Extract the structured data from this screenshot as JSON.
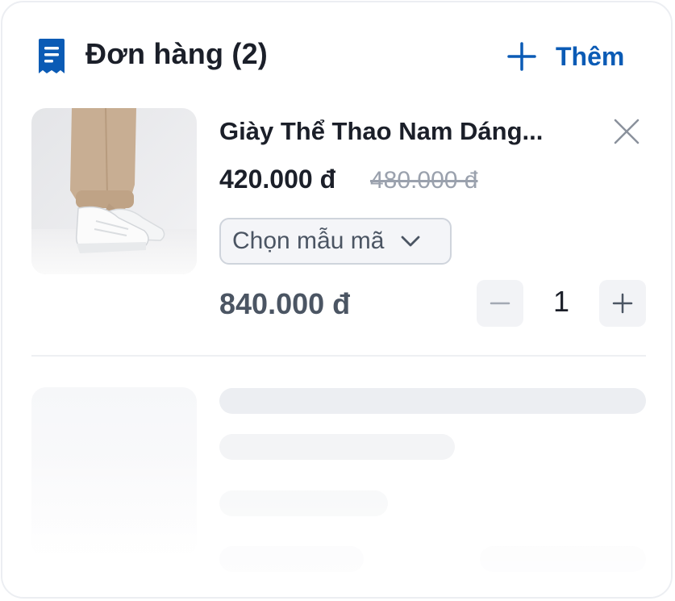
{
  "header": {
    "title": "Đơn hàng (2)",
    "add_label": "Thêm",
    "receipt_icon": "receipt-icon",
    "add_icon": "plus-icon"
  },
  "order_item": {
    "name": "Giày Thể Thao Nam Dáng...",
    "price": "420.000 đ",
    "old_price": "480.000 đ",
    "variant_select": {
      "selected": "Chọn mẫu mã",
      "icon": "chevron-down-icon"
    },
    "subtotal": "840.000 đ",
    "quantity": "1",
    "remove_icon": "close-icon",
    "minus_icon": "minus-icon",
    "plus_icon": "plus-icon"
  },
  "colors": {
    "accent": "#0b5bb5",
    "text_primary": "#1b1f29",
    "text_secondary": "#4b5563",
    "muted": "#9aa1ad",
    "skeleton": "#eceef2"
  }
}
